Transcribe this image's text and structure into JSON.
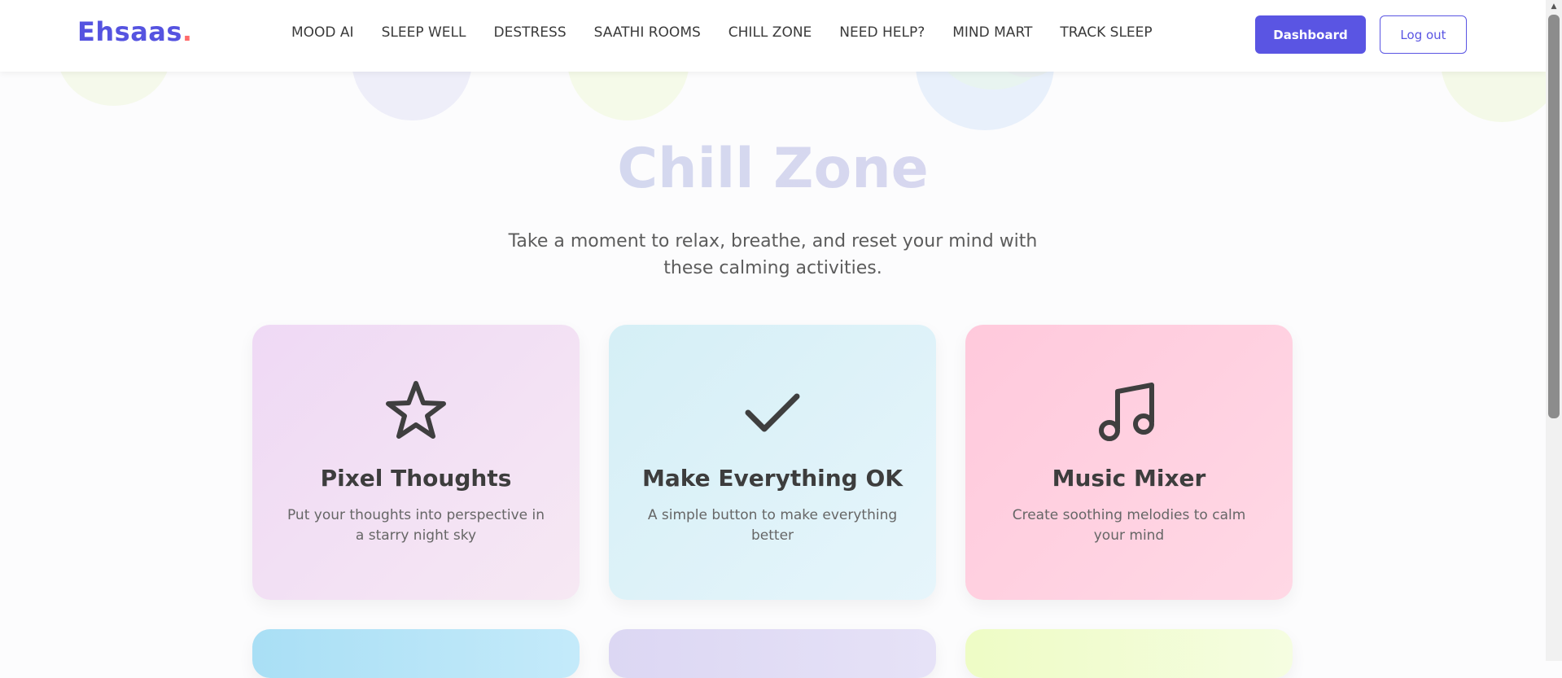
{
  "brand": {
    "name": "Ehsaas",
    "dot": ".",
    "primary_color": "#5a55e3",
    "dot_color": "#ff6b6b"
  },
  "nav": {
    "links": [
      {
        "label": "MOOD AI"
      },
      {
        "label": "SLEEP WELL"
      },
      {
        "label": "DESTRESS"
      },
      {
        "label": "SAATHI ROOMS"
      },
      {
        "label": "CHILL ZONE"
      },
      {
        "label": "NEED HELP?"
      },
      {
        "label": "MIND MART"
      },
      {
        "label": "TRACK SLEEP"
      }
    ],
    "dashboard_label": "Dashboard",
    "logout_label": "Log out"
  },
  "hero": {
    "title": "Chill Zone",
    "subtitle": "Take a moment to relax, breathe, and reset your mind with these calming activities."
  },
  "cards": [
    {
      "icon": "star-icon",
      "title": "Pixel Thoughts",
      "description": "Put your thoughts into perspective in a starry night sky",
      "color": "#efd9f5"
    },
    {
      "icon": "check-icon",
      "title": "Make Everything OK",
      "description": "A simple button to make everything better",
      "color": "#d5eff6"
    },
    {
      "icon": "music-note-icon",
      "title": "Music Mixer",
      "description": "Create soothing melodies to calm your mind",
      "color": "#ffc9dc"
    },
    {
      "color": "#a9dff5"
    },
    {
      "color": "#dcd7f3"
    },
    {
      "color": "#eefcc5"
    }
  ]
}
